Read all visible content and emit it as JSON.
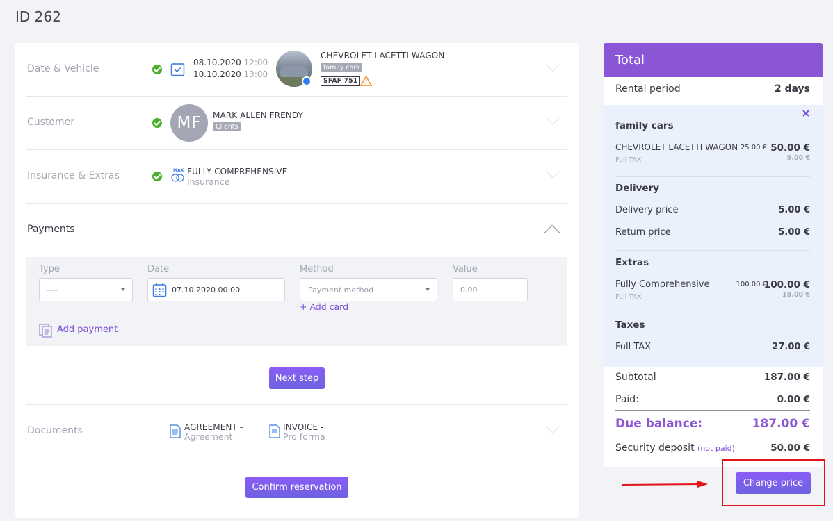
{
  "page": {
    "title": "ID 262"
  },
  "sections": {
    "date_vehicle": {
      "label": "Date & Vehicle",
      "start_date": "08.10.2020",
      "start_time": "12:00",
      "end_date": "10.10.2020",
      "end_time": "13:00",
      "vehicle_name": "CHEVROLET LACETTI WAGON",
      "vehicle_group": "family cars",
      "plate": "SFAF 751"
    },
    "customer": {
      "label": "Customer",
      "initials": "MF",
      "name": "MARK ALLEN FRENDY",
      "group": "Clients"
    },
    "insurance": {
      "label": "Insurance & Extras",
      "title": "FULLY COMPREHENSIVE",
      "subtitle": "Insurance",
      "badge": "MAX"
    },
    "payments": {
      "label": "Payments",
      "type_label": "Type",
      "type_value": "----",
      "date_label": "Date",
      "date_value": "07.10.2020 00:00",
      "method_label": "Method",
      "method_placeholder": "Payment method",
      "add_card": "+ Add card",
      "value_label": "Value",
      "value_placeholder": "0.00",
      "add_payment": "Add payment",
      "next_step": "Next step"
    },
    "documents": {
      "label": "Documents",
      "doc1_title": "AGREEMENT -",
      "doc1_sub": "Agreement",
      "doc2_title": "INVOICE -",
      "doc2_sub": "Pro forma"
    },
    "confirm": "Confirm reservation"
  },
  "total": {
    "header": "Total",
    "rental_period_label": "Rental period",
    "rental_period_value": "2 days",
    "group_title": "family cars",
    "vehicle_line": "CHEVROLET LACETTI WAGON",
    "vehicle_unit": "25.00 €",
    "vehicle_total": "50.00 €",
    "vehicle_tax_label": "Full TAX",
    "vehicle_tax_value": "9.00 €",
    "delivery_title": "Delivery",
    "delivery_price_label": "Delivery price",
    "delivery_price_value": "5.00 €",
    "return_price_label": "Return price",
    "return_price_value": "5.00 €",
    "extras_title": "Extras",
    "extra_line": "Fully Comprehensive",
    "extra_unit": "100.00 €",
    "extra_total": "100.00 €",
    "extra_tax_label": "Full TAX",
    "extra_tax_value": "18.00 €",
    "taxes_title": "Taxes",
    "tax_label": "Full TAX",
    "tax_value": "27.00 €",
    "subtotal_label": "Subtotal",
    "subtotal_value": "187.00 €",
    "paid_label": "Paid:",
    "paid_value": "0.00 €",
    "due_label": "Due balance:",
    "due_value": "187.00 €",
    "deposit_label": "Security deposit",
    "deposit_status": "(not paid)",
    "deposit_value": "50.00 €",
    "change_price": "Change price"
  },
  "colors": {
    "accent": "#8b56d6",
    "button": "#7a5ff0",
    "success": "#4caf2f",
    "annotation": "#e3131b"
  }
}
